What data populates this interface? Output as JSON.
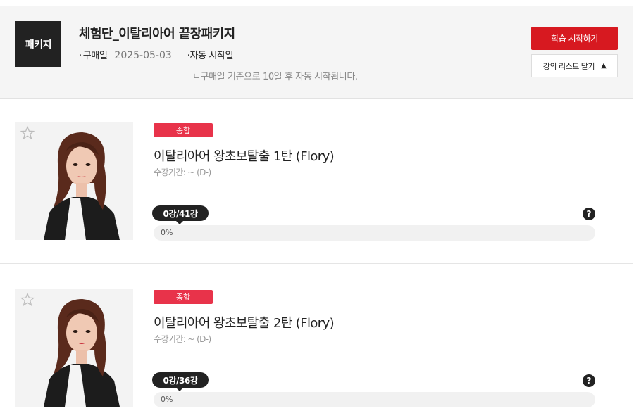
{
  "package": {
    "badge": "패키지",
    "title": "체험단_이탈리아어 끝장패키지",
    "purchase_label": "구매일",
    "purchase_date": "2025-05-03",
    "auto_start_label": "자동 시작일",
    "auto_start_note": "ㄴ구매일 기준으로 10일 후 자동 시작됩니다.",
    "start_button": "학습 시작하기",
    "close_list_button": "강의 리스트 닫기"
  },
  "colors": {
    "accent_red": "#d71920",
    "tag_red": "#e8334a",
    "dark": "#222222"
  },
  "courses": [
    {
      "tag": "종합",
      "title": "이탈리아어 왕초보탈출 1탄 (Flory)",
      "period": "수강기간: ~ (D-)",
      "lecture_count": "0강/41강",
      "progress_text": "0%",
      "progress": 0,
      "favorite_icon": "star-outline-icon",
      "help_icon": "question-icon"
    },
    {
      "tag": "종합",
      "title": "이탈리아어 왕초보탈출 2탄 (Flory)",
      "period": "수강기간: ~ (D-)",
      "lecture_count": "0강/36강",
      "progress_text": "0%",
      "progress": 0,
      "favorite_icon": "star-outline-icon",
      "help_icon": "question-icon"
    }
  ]
}
